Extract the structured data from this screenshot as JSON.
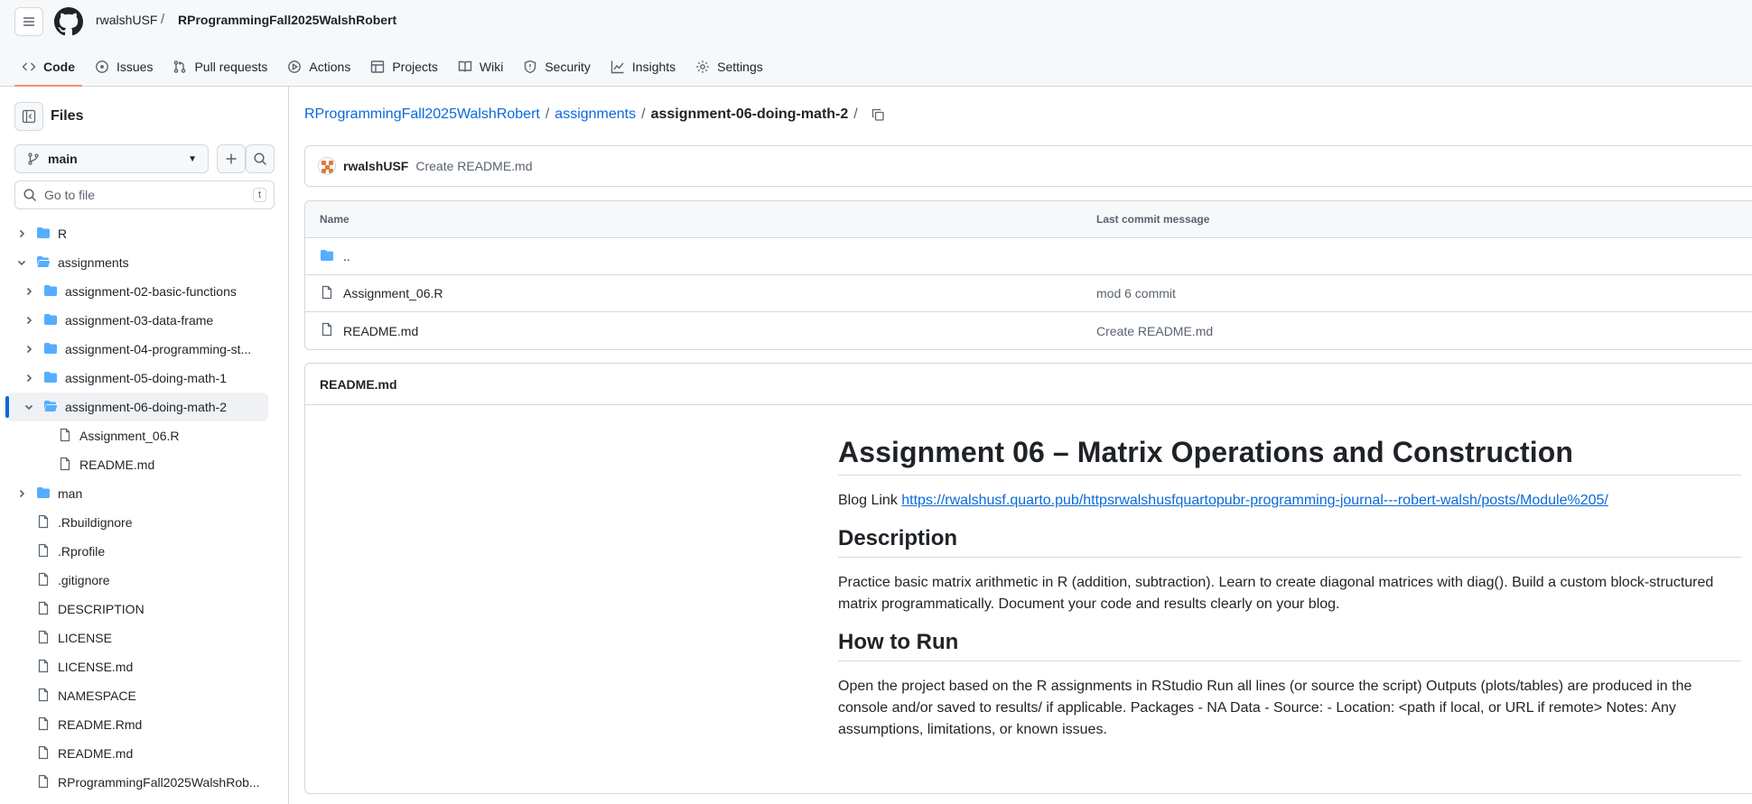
{
  "header": {
    "owner": "rwalshUSF",
    "separator": "/",
    "repo": "RProgrammingFall2025WalshRobert"
  },
  "tabs": [
    {
      "label": "Code",
      "icon": "code-icon"
    },
    {
      "label": "Issues",
      "icon": "issue-icon"
    },
    {
      "label": "Pull requests",
      "icon": "pull-request-icon"
    },
    {
      "label": "Actions",
      "icon": "play-icon"
    },
    {
      "label": "Projects",
      "icon": "table-icon"
    },
    {
      "label": "Wiki",
      "icon": "book-icon"
    },
    {
      "label": "Security",
      "icon": "shield-icon"
    },
    {
      "label": "Insights",
      "icon": "graph-icon"
    },
    {
      "label": "Settings",
      "icon": "gear-icon"
    }
  ],
  "sidebar": {
    "title": "Files",
    "branch": "main",
    "goto_placeholder": "Go to file",
    "goto_shortcut": "t",
    "tree": [
      {
        "label": "R",
        "type": "dir",
        "expanded": false
      },
      {
        "label": "assignments",
        "type": "dir",
        "expanded": true
      },
      {
        "label": "assignment-02-basic-functions",
        "type": "dir",
        "expanded": false
      },
      {
        "label": "assignment-03-data-frame",
        "type": "dir",
        "expanded": false
      },
      {
        "label": "assignment-04-programming-st...",
        "type": "dir",
        "expanded": false
      },
      {
        "label": "assignment-05-doing-math-1",
        "type": "dir",
        "expanded": false
      },
      {
        "label": "assignment-06-doing-math-2",
        "type": "dir",
        "expanded": true
      },
      {
        "label": "Assignment_06.R",
        "type": "file"
      },
      {
        "label": "README.md",
        "type": "file"
      },
      {
        "label": "man",
        "type": "dir",
        "expanded": false
      },
      {
        "label": ".Rbuildignore",
        "type": "file"
      },
      {
        "label": ".Rprofile",
        "type": "file"
      },
      {
        "label": ".gitignore",
        "type": "file"
      },
      {
        "label": "DESCRIPTION",
        "type": "file"
      },
      {
        "label": "LICENSE",
        "type": "file"
      },
      {
        "label": "LICENSE.md",
        "type": "file"
      },
      {
        "label": "NAMESPACE",
        "type": "file"
      },
      {
        "label": "README.Rmd",
        "type": "file"
      },
      {
        "label": "README.md",
        "type": "file"
      },
      {
        "label": "RProgrammingFall2025WalshRob...",
        "type": "file"
      }
    ]
  },
  "breadcrumb": {
    "repo": "RProgrammingFall2025WalshRobert",
    "folder": "assignments",
    "current": "assignment-06-doing-math-2",
    "sep": "/"
  },
  "commit": {
    "user": "rwalshUSF",
    "message": "Create README.md"
  },
  "file_table": {
    "col_name": "Name",
    "col_message": "Last commit message",
    "rows": [
      {
        "name": "..",
        "type": "dir",
        "message": ""
      },
      {
        "name": "Assignment_06.R",
        "type": "file",
        "message": "mod 6 commit"
      },
      {
        "name": "README.md",
        "type": "file",
        "message": "Create README.md"
      }
    ]
  },
  "readme": {
    "filename": "README.md",
    "title": "Assignment 06 – Matrix Operations and Construction",
    "blog_prefix": "Blog Link ",
    "blog_url": "https://rwalshusf.quarto.pub/httpsrwalshusfquartopubr-programming-journal---robert-walsh/posts/Module%205/",
    "h_description": "Description",
    "description": "Practice basic matrix arithmetic in R (addition, subtraction). Learn to create diagonal matrices with diag(). Build a custom block-structured matrix programmatically. Document your code and results clearly on your blog.",
    "h_run": "How to Run",
    "run_text": "Open the project based on the R assignments in RStudio Run all lines (or source the script) Outputs (plots/tables) are produced in the console and/or saved to results/ if applicable. Packages - NA Data - Source: - Location: <path if local, or URL if remote> Notes: Any assumptions, limitations, or known issues."
  },
  "colors": {
    "accent_link": "#0969da",
    "tab_underline": "#fd8c73",
    "folder": "#54aeff"
  }
}
